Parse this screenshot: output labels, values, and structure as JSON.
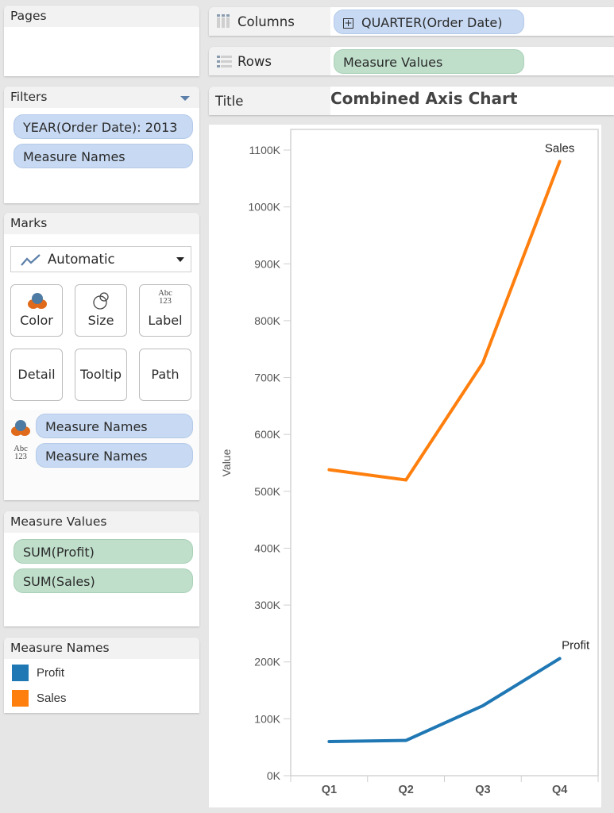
{
  "pages": {
    "title": "Pages"
  },
  "filters": {
    "title": "Filters",
    "items": [
      "YEAR(Order Date): 2013",
      "Measure Names"
    ]
  },
  "marks": {
    "title": "Marks",
    "mark_type": "Automatic",
    "buttons": [
      {
        "label": "Color",
        "icon": "color-icon"
      },
      {
        "label": "Size",
        "icon": "size-icon"
      },
      {
        "label": "Label",
        "icon": "label-icon"
      },
      {
        "label": "Detail"
      },
      {
        "label": "Tooltip"
      },
      {
        "label": "Path"
      }
    ],
    "icon_text_abc": "Abc",
    "icon_text_123": "123",
    "encodings": [
      {
        "type": "color",
        "field": "Measure Names"
      },
      {
        "type": "label",
        "field": "Measure Names"
      }
    ]
  },
  "measure_values": {
    "title": "Measure Values",
    "items": [
      "SUM(Profit)",
      "SUM(Sales)"
    ]
  },
  "legend": {
    "title": "Measure Names",
    "items": [
      {
        "label": "Profit",
        "color": "#1f77b4"
      },
      {
        "label": "Sales",
        "color": "#ff7f0e"
      }
    ]
  },
  "shelves": {
    "columns": {
      "label": "Columns",
      "pill": "QUARTER(Order Date)",
      "pill_prefix": "+"
    },
    "rows": {
      "label": "Rows",
      "pill": "Measure Values"
    },
    "title": {
      "label": "Title",
      "value": "Combined Axis Chart"
    }
  },
  "chart_data": {
    "type": "line",
    "title": "Combined Axis Chart",
    "xlabel": "",
    "ylabel": "Value",
    "categories": [
      "Q1",
      "Q2",
      "Q3",
      "Q4"
    ],
    "ylim": [
      0,
      1100000
    ],
    "yticks": [
      0,
      100000,
      200000,
      300000,
      400000,
      500000,
      600000,
      700000,
      800000,
      900000,
      1000000,
      1100000
    ],
    "ytick_labels": [
      "0K",
      "100K",
      "200K",
      "300K",
      "400K",
      "500K",
      "600K",
      "700K",
      "800K",
      "900K",
      "1000K",
      "1100K"
    ],
    "grid": false,
    "legend": "left-panel",
    "series": [
      {
        "name": "Sales",
        "color": "#ff7f0e",
        "values": [
          538000,
          520000,
          726000,
          1080000
        ],
        "end_label": "Sales"
      },
      {
        "name": "Profit",
        "color": "#1f77b4",
        "values": [
          60000,
          62000,
          123000,
          206000
        ],
        "end_label": "Profit"
      }
    ]
  }
}
